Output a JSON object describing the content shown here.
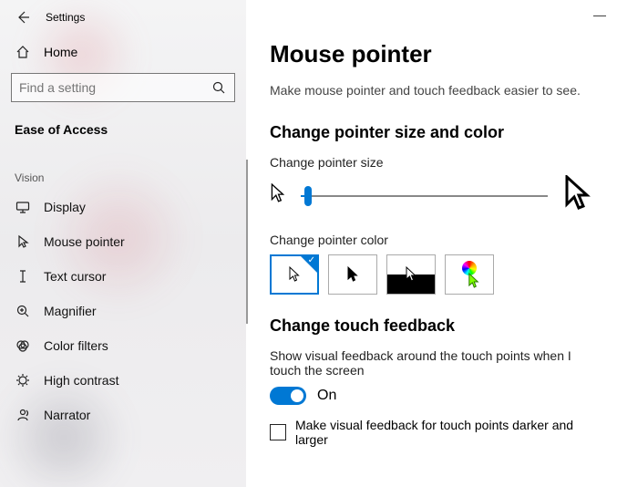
{
  "window": {
    "title": "Settings"
  },
  "sidebar": {
    "home": "Home",
    "search_placeholder": "Find a setting",
    "category": "Ease of Access",
    "group": "Vision",
    "items": [
      {
        "label": "Display"
      },
      {
        "label": "Mouse pointer"
      },
      {
        "label": "Text cursor"
      },
      {
        "label": "Magnifier"
      },
      {
        "label": "Color filters"
      },
      {
        "label": "High contrast"
      },
      {
        "label": "Narrator"
      }
    ]
  },
  "main": {
    "title": "Mouse pointer",
    "description": "Make mouse pointer and touch feedback easier to see.",
    "section_size_color": "Change pointer size and color",
    "size_label": "Change pointer size",
    "color_label": "Change pointer color",
    "section_touch": "Change touch feedback",
    "touch_desc": "Show visual feedback around the touch points when I touch the screen",
    "toggle_state": "On",
    "checkbox_label": "Make visual feedback for touch points darker and larger"
  }
}
